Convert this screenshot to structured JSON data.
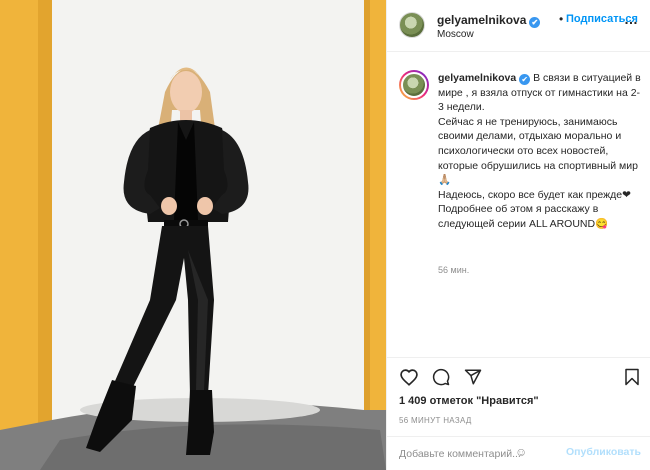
{
  "post": {
    "username": "gelyamelnikova",
    "verified_mark": "✔",
    "separator": "•",
    "follow_label": "Подписаться",
    "location": "Moscow",
    "more_icon": "…"
  },
  "caption": {
    "username": "gelyamelnikova",
    "text": "В связи в ситуацией в мире , я взяла отпуск от гимнастики на 2-3 недели.\nСейчас я не тренируюсь, занимаюсь своими делами, отдыхаю морально и психологически ото всех новостей, которые обрушились на спортивный мир🙏🏼\nНадеюсь, скоро все будет как прежде❤\nПодробнее об этом я расскажу в следующей серии ALL AROUND😋",
    "time_ago": "56 мин."
  },
  "actions": {
    "icons": [
      "heart-icon",
      "comment-icon",
      "share-icon",
      "bookmark-icon"
    ],
    "likes_count": "1 409",
    "likes_text": "отметок",
    "likes_quote": "\"Нравится\"",
    "posted_ago": "56 МИНУТ НАЗАД"
  },
  "comment": {
    "placeholder": "Добавьте комментарий...",
    "emoji": "☺",
    "publish_label": "Опубликовать"
  },
  "colors": {
    "accent": "#0095f6",
    "publish_disabled": "#b2dffc",
    "wall": "#f1f1ef",
    "yellow_pillar": "#f0b43b"
  }
}
